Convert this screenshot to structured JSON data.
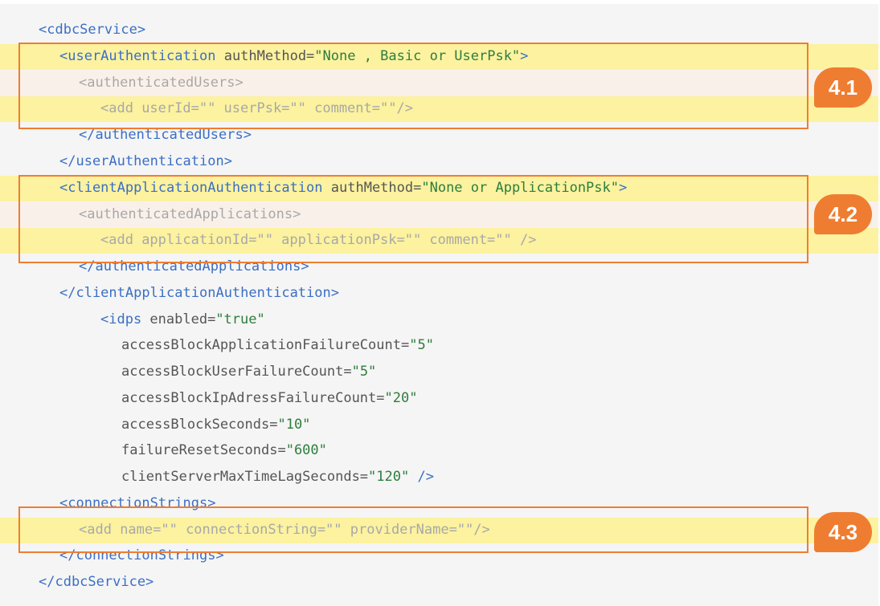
{
  "lines": [
    {
      "parts": [
        {
          "t": "<cdbcService>",
          "c": "tag"
        }
      ]
    },
    {
      "parts": [
        {
          "t": "<userAuthentication ",
          "c": "tag"
        },
        {
          "t": "authMethod=",
          "c": "attr"
        },
        {
          "t": "\"None , Basic or UserPsk\"",
          "c": "val"
        },
        {
          "t": ">",
          "c": "tag"
        }
      ]
    },
    {
      "parts": [
        {
          "t": "<authenticatedUsers>",
          "c": "tag"
        }
      ]
    },
    {
      "parts": [
        {
          "t": "<add ",
          "c": "tag"
        },
        {
          "t": "userId=\"\" userPsk=\"\" comment=\"\"",
          "c": "attr"
        },
        {
          "t": "/>",
          "c": "tag"
        }
      ]
    },
    {
      "parts": [
        {
          "t": "</authenticatedUsers>",
          "c": "tag"
        }
      ]
    },
    {
      "parts": [
        {
          "t": "</userAuthentication>",
          "c": "tag"
        }
      ]
    },
    {
      "parts": [
        {
          "t": "<clientApplicationAuthentication ",
          "c": "tag"
        },
        {
          "t": "authMethod=",
          "c": "attr"
        },
        {
          "t": "\"None or ApplicationPsk\"",
          "c": "val"
        },
        {
          "t": ">",
          "c": "tag"
        }
      ]
    },
    {
      "parts": [
        {
          "t": "<authenticatedApplications>",
          "c": "tag"
        }
      ]
    },
    {
      "parts": [
        {
          "t": "<add ",
          "c": "tag"
        },
        {
          "t": "applicationId=\"\" applicationPsk=\"\" comment=\"\" ",
          "c": "attr"
        },
        {
          "t": "/>",
          "c": "tag"
        }
      ]
    },
    {
      "parts": [
        {
          "t": "</authenticatedApplications>",
          "c": "tag"
        }
      ]
    },
    {
      "parts": [
        {
          "t": "</clientApplicationAuthentication>",
          "c": "tag"
        }
      ]
    },
    {
      "parts": [
        {
          "t": "<idps ",
          "c": "tag"
        },
        {
          "t": "enabled=",
          "c": "attr"
        },
        {
          "t": "\"true\"",
          "c": "val"
        }
      ]
    },
    {
      "parts": [
        {
          "t": "accessBlockApplicationFailureCount=",
          "c": "attr"
        },
        {
          "t": "\"5\"",
          "c": "val"
        }
      ]
    },
    {
      "parts": [
        {
          "t": "accessBlockUserFailureCount=",
          "c": "attr"
        },
        {
          "t": "\"5\"",
          "c": "val"
        }
      ]
    },
    {
      "parts": [
        {
          "t": "accessBlockIpAdressFailureCount=",
          "c": "attr"
        },
        {
          "t": "\"20\"",
          "c": "val"
        }
      ]
    },
    {
      "parts": [
        {
          "t": "accessBlockSeconds=",
          "c": "attr"
        },
        {
          "t": "\"10\"",
          "c": "val"
        }
      ]
    },
    {
      "parts": [
        {
          "t": "failureResetSeconds=",
          "c": "attr"
        },
        {
          "t": "\"600\"",
          "c": "val"
        }
      ]
    },
    {
      "parts": [
        {
          "t": "clientServerMaxTimeLagSeconds=",
          "c": "attr"
        },
        {
          "t": "\"120\"",
          "c": "val"
        },
        {
          "t": " />",
          "c": "tag"
        }
      ]
    },
    {
      "parts": [
        {
          "t": "<connectionStrings>",
          "c": "tag"
        }
      ]
    },
    {
      "parts": [
        {
          "t": "<add ",
          "c": "tag"
        },
        {
          "t": "name=\"\" connectionString=\"\" providerName=\"\"",
          "c": "attr"
        },
        {
          "t": "/>",
          "c": "tag"
        }
      ]
    },
    {
      "parts": [
        {
          "t": "</connectionStrings>",
          "c": "tag"
        }
      ]
    },
    {
      "parts": [
        {
          "t": "</cdbcService>",
          "c": "tag"
        }
      ]
    }
  ],
  "badges": [
    "4.1",
    "4.2",
    "4.3"
  ],
  "colors": {
    "accent": "#ef7d31",
    "highlight": "#fcf29f",
    "tag": "#3b6fc4",
    "value": "#2e7d3e"
  }
}
